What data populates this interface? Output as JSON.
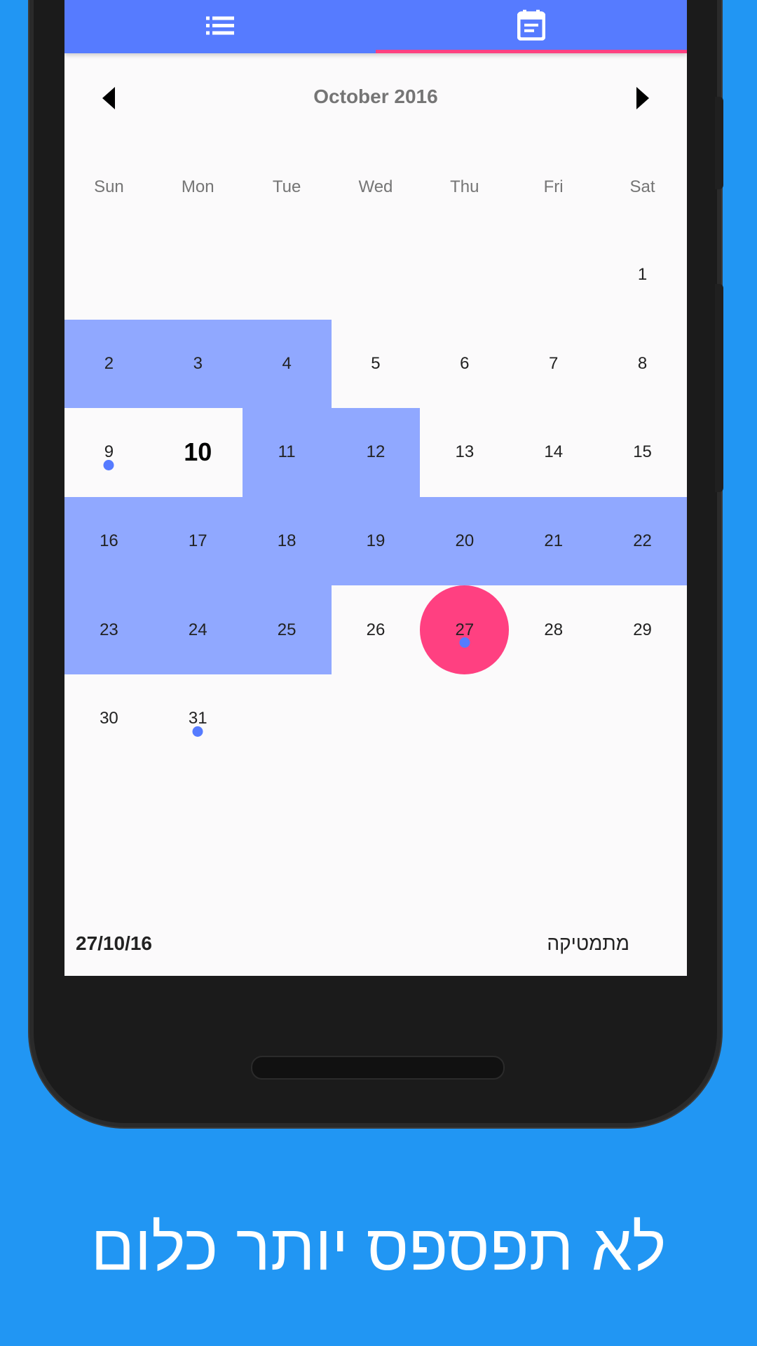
{
  "colors": {
    "background": "#2196F3",
    "tabbar": "#567BFF",
    "accent": "#FF4081",
    "range": "#90A8FF",
    "event_dot": "#567BFF"
  },
  "tabs": [
    {
      "icon": "list-icon",
      "selected": false
    },
    {
      "icon": "calendar-icon",
      "selected": true
    }
  ],
  "calendar": {
    "month_title": "October 2016",
    "weekdays": [
      "Sun",
      "Mon",
      "Tue",
      "Wed",
      "Thu",
      "Fri",
      "Sat"
    ],
    "first_weekday_index": 6,
    "days_in_month": 31,
    "today": 10,
    "selected": 27,
    "range_days": [
      2,
      3,
      4,
      11,
      12,
      16,
      17,
      18,
      19,
      20,
      21,
      22,
      23,
      24,
      25
    ],
    "event_days": [
      9,
      27,
      31
    ]
  },
  "footer": {
    "date": "27/10/16",
    "subject": "מתמטיקה"
  },
  "tagline": "לא תפספס יותר כלום"
}
